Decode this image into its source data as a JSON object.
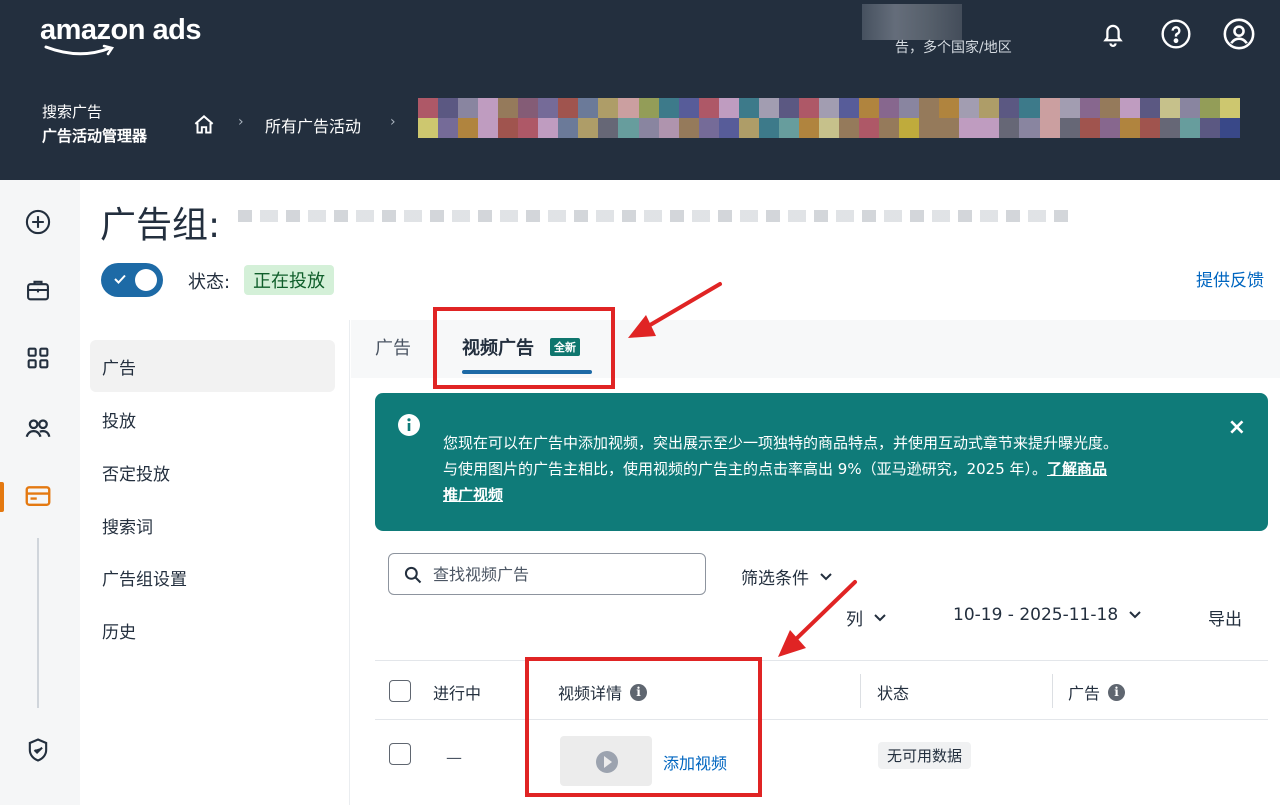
{
  "header": {
    "logo": "amazon ads",
    "region": "告，多个国家/地区",
    "section": "搜索广告",
    "app": "广告活动管理器",
    "breadcrumb": "所有广告活动",
    "icons": [
      "bell-icon",
      "help-icon",
      "account-icon",
      "home-icon"
    ]
  },
  "rail": {
    "icons": [
      "plus-circle-icon",
      "briefcase-icon",
      "apps-grid-icon",
      "people-icon",
      "campaigns-card-icon",
      "shield-icon"
    ]
  },
  "page": {
    "title": "广告组:",
    "status_label": "状态:",
    "status_value": "正在投放",
    "feedback": "提供反馈"
  },
  "subnav": {
    "items": [
      "广告",
      "投放",
      "否定投放",
      "搜索词",
      "广告组设置",
      "历史"
    ]
  },
  "tabs": {
    "items": [
      "广告",
      "视频广告"
    ],
    "new_badge": "全新"
  },
  "banner": {
    "line1": "您现在可以在广告中添加视频，突出展示至少一项独特的商品特点，并使用互动式章节来提升曝光度。",
    "line2": "与使用图片的广告主相比，使用视频的广告主的点击率高出 9%（亚马逊研究，2025 年）。",
    "link_a": "了解商品",
    "link_b": "推广视频",
    "close": "×"
  },
  "toolbar": {
    "search_placeholder": "查找视频广告",
    "filter": "筛选条件",
    "columns": "列",
    "date_range": "10-19 - 2025-11-18",
    "export": "导出"
  },
  "table": {
    "headers": [
      "进行中",
      "视频详情",
      "状态",
      "广告"
    ],
    "rows": [
      {
        "active": "—",
        "video_action": "添加视频",
        "status": "无可用数据"
      }
    ]
  },
  "colors": {
    "header_bg": "#232f3e",
    "accent": "#1d6aa6",
    "banner_bg": "#0f7b79",
    "status_bg": "#d4f0d8",
    "callout": "#e02424",
    "rail_active": "#e47911"
  }
}
